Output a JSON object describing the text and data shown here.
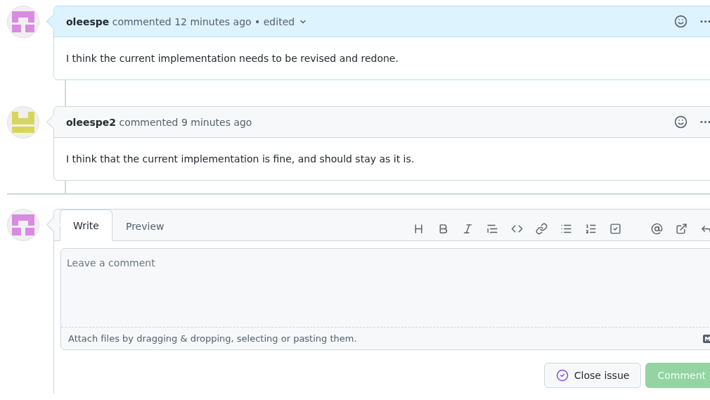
{
  "comments": [
    {
      "header": "**oleespe** commented 12 minutes ago • edited",
      "has_menu": true,
      "highlighted": true,
      "color": "#d98be0",
      "body": "I think the current implementation needs to be revised and redone."
    },
    {
      "header": "**oleespe2** commented 9 minutes ago",
      "has_menu": false,
      "highlighted": false,
      "color": "#d8d65a",
      "body": "I think that the current implementation is fine, and should stay as it is."
    }
  ],
  "editor": {
    "color": "#d98be0",
    "tabs": [
      {
        "label": "Write",
        "selected": true
      },
      {
        "label": "Preview",
        "selected": false
      }
    ],
    "placeholder": "Leave a comment",
    "attach_hint": "Attach files by dragging & dropping, selecting or pasting them.",
    "close_button": {
      "label": "Close issue"
    },
    "comment_button": {
      "label": "Comment",
      "disabled": true
    }
  }
}
